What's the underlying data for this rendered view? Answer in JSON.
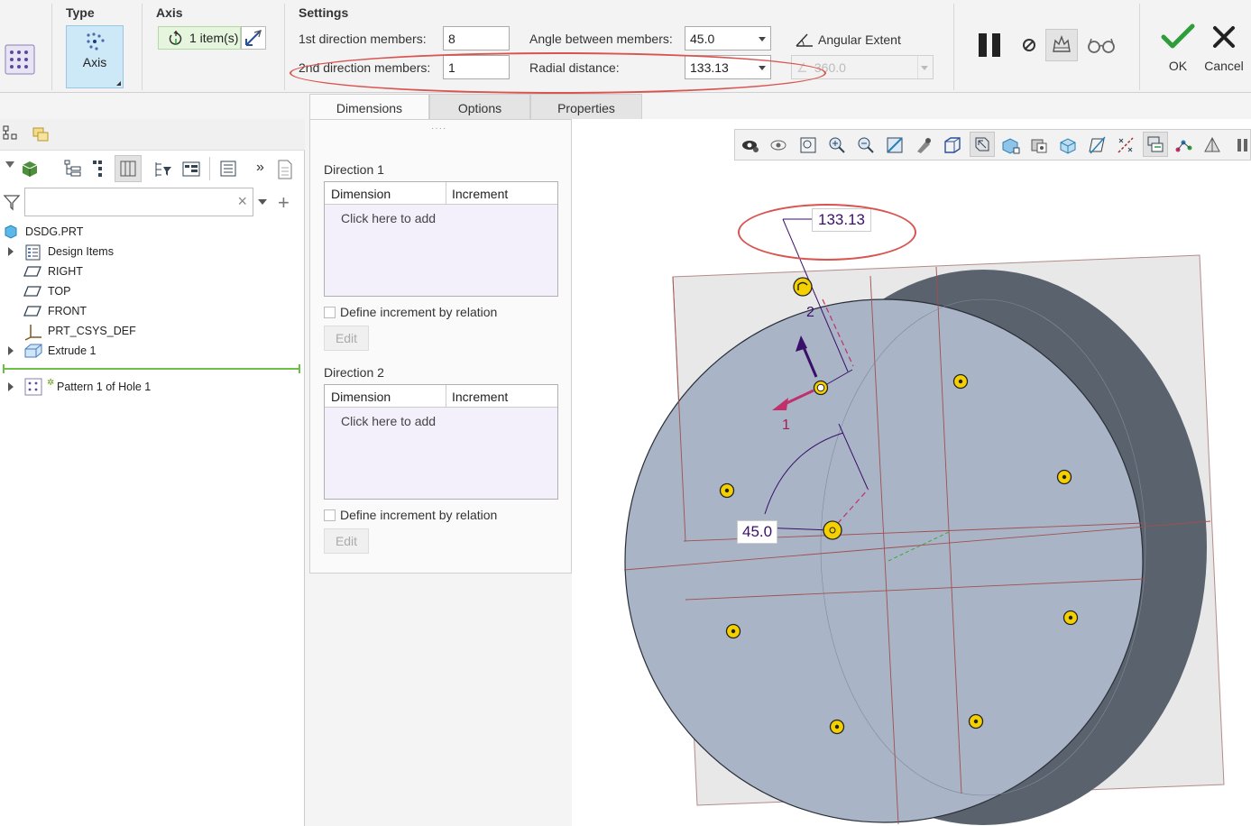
{
  "ribbon": {
    "type_title": "Type",
    "type_button": "Axis",
    "axis_title": "Axis",
    "axis_collector": "1 item(s)",
    "settings_title": "Settings",
    "dir1_label": "1st direction members:",
    "dir1_value": "8",
    "dir2_label": "2nd direction members:",
    "dir2_value": "1",
    "angle_label": "Angle between members:",
    "angle_value": "45.0",
    "radial_label": "Radial distance:",
    "radial_value": "133.13",
    "angular_extent_label": "Angular Extent",
    "angular_extent_value": "360.0",
    "ok_label": "OK",
    "cancel_label": "Cancel"
  },
  "tabs": [
    {
      "label": "Dimensions",
      "active": true
    },
    {
      "label": "Options",
      "active": false
    },
    {
      "label": "Properties",
      "active": false
    }
  ],
  "dimensions_panel": {
    "direction1": {
      "title": "Direction 1",
      "col_dimension": "Dimension",
      "col_increment": "Increment",
      "placeholder": "Click here to add",
      "relation_label": "Define increment by relation",
      "edit_label": "Edit"
    },
    "direction2": {
      "title": "Direction 2",
      "col_dimension": "Dimension",
      "col_increment": "Increment",
      "placeholder": "Click here to add",
      "relation_label": "Define increment by relation",
      "edit_label": "Edit"
    }
  },
  "model_tree": {
    "search_clear": "×",
    "more": "»",
    "items": [
      {
        "label": "DSDG.PRT",
        "icon": "part-icon"
      },
      {
        "label": "Design Items",
        "icon": "design-items-icon"
      },
      {
        "label": "RIGHT",
        "icon": "datum-plane-icon"
      },
      {
        "label": "TOP",
        "icon": "datum-plane-icon"
      },
      {
        "label": "FRONT",
        "icon": "datum-plane-icon"
      },
      {
        "label": "PRT_CSYS_DEF",
        "icon": "csys-icon"
      },
      {
        "label": "Extrude 1",
        "icon": "extrude-icon"
      },
      {
        "label": "Pattern 1 of Hole 1",
        "icon": "pattern-icon"
      }
    ]
  },
  "graphics": {
    "radial_dim": "133.13",
    "angle_dim": "45.0",
    "dir1_tag": "1",
    "dir2_tag": "2"
  },
  "colors": {
    "accent_green": "#2e9d3a",
    "annotation_red": "#d9534f",
    "face_blue": "#a9b4c6",
    "side_dark": "#5a626d",
    "pattern_yellow": "#f5d000",
    "dim_text": "#3a0f6a"
  }
}
